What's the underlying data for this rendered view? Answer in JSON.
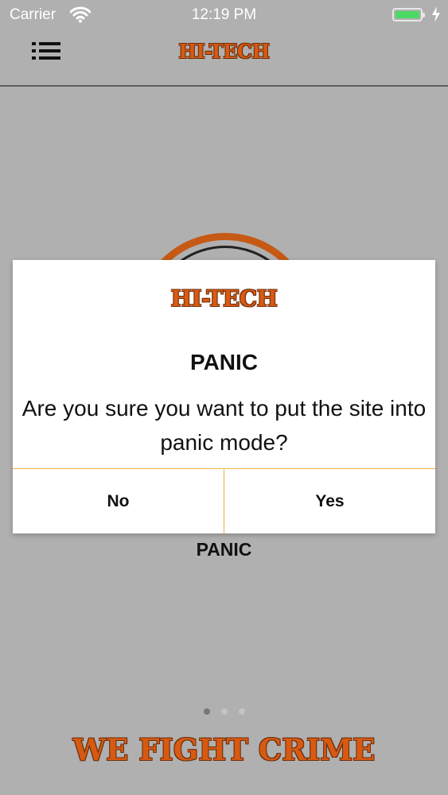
{
  "status_bar": {
    "carrier": "Carrier",
    "time": "12:19 PM",
    "battery_level": 1.0
  },
  "nav": {
    "title": "HI-TECH",
    "menu_icon": "list-icon"
  },
  "main": {
    "page_label": "PANIC",
    "page_count": 3,
    "active_page": 1,
    "slogan": "WE FIGHT CRIME"
  },
  "dialog": {
    "brand": "HI-TECH",
    "title": "PANIC",
    "message": "Are you sure you want to put the site into panic mode?",
    "no_label": "No",
    "yes_label": "Yes"
  },
  "colors": {
    "brand_orange": "#d85a12",
    "brand_outline": "#6b2d0a",
    "divider": "#e8b23a",
    "backdrop": "#b0b0b0",
    "battery_green": "#4cd964"
  }
}
